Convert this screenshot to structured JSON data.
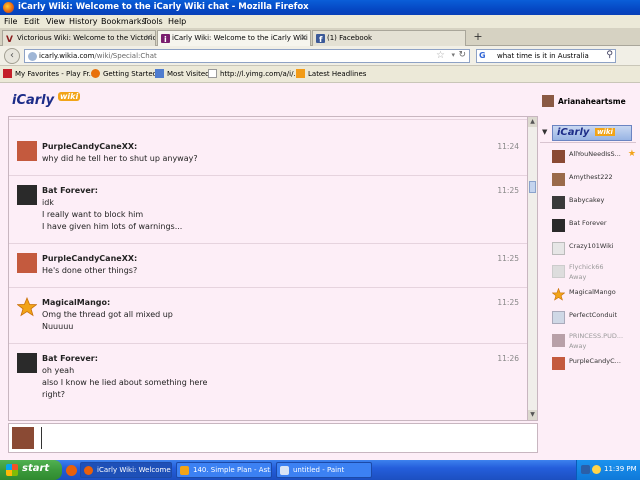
{
  "window": {
    "title": "iCarly Wiki: Welcome to the iCarly Wiki chat - Mozilla Firefox"
  },
  "menu": [
    "File",
    "Edit",
    "View",
    "History",
    "Bookmarks",
    "Tools",
    "Help"
  ],
  "tabs": [
    {
      "label": "Victorious Wiki: Welcome to the Victoriou...",
      "favicon_color": "#8b1d1d",
      "favicon_letter": "V"
    },
    {
      "label": "iCarly Wiki: Welcome to the iCarly Wiki chat",
      "favicon_color": "#7a1e6e",
      "favicon_letter": "i",
      "active": true
    },
    {
      "label": "(1) Facebook",
      "favicon_color": "#3b5998",
      "favicon_letter": "f"
    }
  ],
  "nav": {
    "url_domain": "icarly.wikia.com",
    "url_path": "/wiki/Special:Chat",
    "search_engine": "G",
    "search_query": "what time is it in Australia"
  },
  "bookmarks": [
    {
      "label": "My Favorites - Play Fr...",
      "color": "#c4202a"
    },
    {
      "label": "Getting Started",
      "color": "#e8700b"
    },
    {
      "label": "Most Visited",
      "color": "#4f7ccf"
    },
    {
      "label": "http://l.yimg.com/a/i/...",
      "color": "#ffffff"
    },
    {
      "label": "Latest Headlines",
      "color": "#f29b18"
    }
  ],
  "chat": {
    "logo_text": "iCarly",
    "logo_badge": "wiki",
    "current_user": "Arianaheartsme",
    "messages": [
      {
        "user": "PurpleCandyCaneXX:",
        "time": "11:24",
        "avatar_color": "#c45a3e",
        "lines": [
          "why did he tell her to shut up anyway?"
        ]
      },
      {
        "user": "Bat Forever:",
        "time": "11:25",
        "avatar_color": "#2a2a2a",
        "lines": [
          "idk",
          "I really want to block him",
          "I have given him lots of warnings..."
        ]
      },
      {
        "user": "PurpleCandyCaneXX:",
        "time": "11:25",
        "avatar_color": "#c45a3e",
        "lines": [
          "He's done other things?"
        ]
      },
      {
        "user": "MagicalMango:",
        "time": "11:25",
        "avatar_color": "#e8941a",
        "lines": [
          "Omg the thread got all mixed up",
          "Nuuuuu"
        ]
      },
      {
        "user": "Bat Forever:",
        "time": "11:26",
        "avatar_color": "#2a2a2a",
        "lines": [
          "oh yeah",
          "also I know he lied about something here",
          "right?"
        ]
      }
    ],
    "users": [
      {
        "name": "AllYouNeedIsS...",
        "avatar_color": "#8a4a34",
        "favorite": true
      },
      {
        "name": "Amythest222",
        "avatar_color": "#9a6a4a"
      },
      {
        "name": "Babycakey",
        "avatar_color": "#3a3a3a"
      },
      {
        "name": "Bat Forever",
        "avatar_color": "#2a2a2a"
      },
      {
        "name": "Crazy101Wiki",
        "avatar_color": "#e6e6e6"
      },
      {
        "name": "Flychick66",
        "status": "Away",
        "avatar_color": "#dddddd"
      },
      {
        "name": "MagicalMango",
        "avatar_color": "#e8941a"
      },
      {
        "name": "PerfectConduit",
        "avatar_color": "#cfd8e6"
      },
      {
        "name": "PRINCESS.PUD...",
        "status": "Away",
        "avatar_color": "#b8a0a8"
      },
      {
        "name": "PurpleCandyC...",
        "avatar_color": "#c45a3e"
      }
    ],
    "input_value": ""
  },
  "taskbar": {
    "start_label": "start",
    "tasks": [
      {
        "label": "iCarly Wiki: Welcome ...",
        "color": "#e8600b",
        "active": true
      },
      {
        "label": "140. Simple Plan - Ast...",
        "color": "#f2a418"
      },
      {
        "label": "untitled - Paint",
        "color": "#d9e4f5"
      }
    ],
    "clock": "11:39 PM"
  }
}
